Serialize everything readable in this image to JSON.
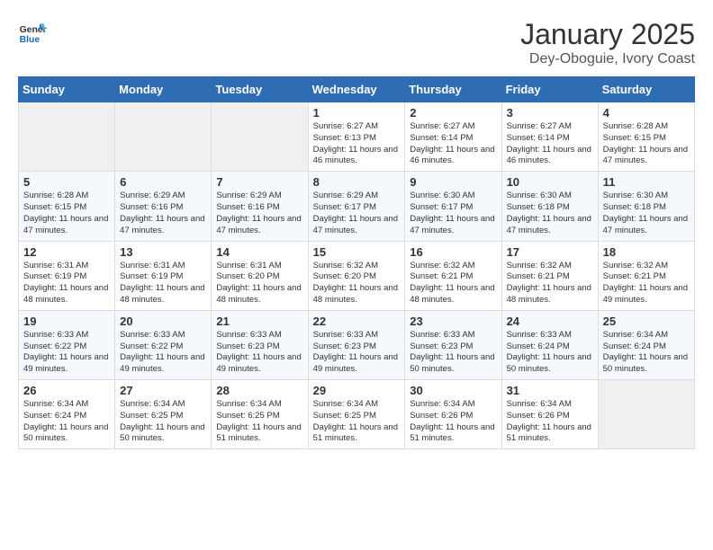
{
  "header": {
    "logo_line1": "General",
    "logo_line2": "Blue",
    "title": "January 2025",
    "subtitle": "Dey-Oboguie, Ivory Coast"
  },
  "weekdays": [
    "Sunday",
    "Monday",
    "Tuesday",
    "Wednesday",
    "Thursday",
    "Friday",
    "Saturday"
  ],
  "weeks": [
    [
      {
        "day": "",
        "text": ""
      },
      {
        "day": "",
        "text": ""
      },
      {
        "day": "",
        "text": ""
      },
      {
        "day": "1",
        "text": "Sunrise: 6:27 AM\nSunset: 6:13 PM\nDaylight: 11 hours and 46 minutes."
      },
      {
        "day": "2",
        "text": "Sunrise: 6:27 AM\nSunset: 6:14 PM\nDaylight: 11 hours and 46 minutes."
      },
      {
        "day": "3",
        "text": "Sunrise: 6:27 AM\nSunset: 6:14 PM\nDaylight: 11 hours and 46 minutes."
      },
      {
        "day": "4",
        "text": "Sunrise: 6:28 AM\nSunset: 6:15 PM\nDaylight: 11 hours and 47 minutes."
      }
    ],
    [
      {
        "day": "5",
        "text": "Sunrise: 6:28 AM\nSunset: 6:15 PM\nDaylight: 11 hours and 47 minutes."
      },
      {
        "day": "6",
        "text": "Sunrise: 6:29 AM\nSunset: 6:16 PM\nDaylight: 11 hours and 47 minutes."
      },
      {
        "day": "7",
        "text": "Sunrise: 6:29 AM\nSunset: 6:16 PM\nDaylight: 11 hours and 47 minutes."
      },
      {
        "day": "8",
        "text": "Sunrise: 6:29 AM\nSunset: 6:17 PM\nDaylight: 11 hours and 47 minutes."
      },
      {
        "day": "9",
        "text": "Sunrise: 6:30 AM\nSunset: 6:17 PM\nDaylight: 11 hours and 47 minutes."
      },
      {
        "day": "10",
        "text": "Sunrise: 6:30 AM\nSunset: 6:18 PM\nDaylight: 11 hours and 47 minutes."
      },
      {
        "day": "11",
        "text": "Sunrise: 6:30 AM\nSunset: 6:18 PM\nDaylight: 11 hours and 47 minutes."
      }
    ],
    [
      {
        "day": "12",
        "text": "Sunrise: 6:31 AM\nSunset: 6:19 PM\nDaylight: 11 hours and 48 minutes."
      },
      {
        "day": "13",
        "text": "Sunrise: 6:31 AM\nSunset: 6:19 PM\nDaylight: 11 hours and 48 minutes."
      },
      {
        "day": "14",
        "text": "Sunrise: 6:31 AM\nSunset: 6:20 PM\nDaylight: 11 hours and 48 minutes."
      },
      {
        "day": "15",
        "text": "Sunrise: 6:32 AM\nSunset: 6:20 PM\nDaylight: 11 hours and 48 minutes."
      },
      {
        "day": "16",
        "text": "Sunrise: 6:32 AM\nSunset: 6:21 PM\nDaylight: 11 hours and 48 minutes."
      },
      {
        "day": "17",
        "text": "Sunrise: 6:32 AM\nSunset: 6:21 PM\nDaylight: 11 hours and 48 minutes."
      },
      {
        "day": "18",
        "text": "Sunrise: 6:32 AM\nSunset: 6:21 PM\nDaylight: 11 hours and 49 minutes."
      }
    ],
    [
      {
        "day": "19",
        "text": "Sunrise: 6:33 AM\nSunset: 6:22 PM\nDaylight: 11 hours and 49 minutes."
      },
      {
        "day": "20",
        "text": "Sunrise: 6:33 AM\nSunset: 6:22 PM\nDaylight: 11 hours and 49 minutes."
      },
      {
        "day": "21",
        "text": "Sunrise: 6:33 AM\nSunset: 6:23 PM\nDaylight: 11 hours and 49 minutes."
      },
      {
        "day": "22",
        "text": "Sunrise: 6:33 AM\nSunset: 6:23 PM\nDaylight: 11 hours and 49 minutes."
      },
      {
        "day": "23",
        "text": "Sunrise: 6:33 AM\nSunset: 6:23 PM\nDaylight: 11 hours and 50 minutes."
      },
      {
        "day": "24",
        "text": "Sunrise: 6:33 AM\nSunset: 6:24 PM\nDaylight: 11 hours and 50 minutes."
      },
      {
        "day": "25",
        "text": "Sunrise: 6:34 AM\nSunset: 6:24 PM\nDaylight: 11 hours and 50 minutes."
      }
    ],
    [
      {
        "day": "26",
        "text": "Sunrise: 6:34 AM\nSunset: 6:24 PM\nDaylight: 11 hours and 50 minutes."
      },
      {
        "day": "27",
        "text": "Sunrise: 6:34 AM\nSunset: 6:25 PM\nDaylight: 11 hours and 50 minutes."
      },
      {
        "day": "28",
        "text": "Sunrise: 6:34 AM\nSunset: 6:25 PM\nDaylight: 11 hours and 51 minutes."
      },
      {
        "day": "29",
        "text": "Sunrise: 6:34 AM\nSunset: 6:25 PM\nDaylight: 11 hours and 51 minutes."
      },
      {
        "day": "30",
        "text": "Sunrise: 6:34 AM\nSunset: 6:26 PM\nDaylight: 11 hours and 51 minutes."
      },
      {
        "day": "31",
        "text": "Sunrise: 6:34 AM\nSunset: 6:26 PM\nDaylight: 11 hours and 51 minutes."
      },
      {
        "day": "",
        "text": ""
      }
    ]
  ]
}
